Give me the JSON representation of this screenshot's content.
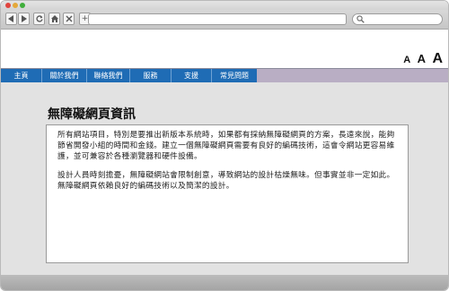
{
  "menu": {
    "items": [
      "主頁",
      "關於我們",
      "聯絡我們",
      "服務",
      "支援",
      "常見問題"
    ]
  },
  "font_size_controls": {
    "small": "A",
    "medium": "A",
    "large": "A"
  },
  "toolbar": {
    "new_tab": "+"
  },
  "main": {
    "title": "無障礙網頁資訊",
    "paragraphs": [
      "所有網站項目，特別是要推出新版本系統時，如果都有採納無障礙網頁的方案，長遠來說，能夠節省開發小組的時間和金錢。建立一個無障礙網頁需要有良好的編碼技術，這會令網站更容易維護，並可兼容於各種瀏覽器和硬件設備。",
      "設計人員時刻擔憂，無障礙網站會限制創意，導致網站的設計枯燥無味。但事實並非一定如此。無障礙網頁依賴良好的編碼技術以及簡潔的設計。"
    ]
  },
  "colors": {
    "menu_blue": "#1f6cb5",
    "menu_lavender": "#b9aec4",
    "content_bg": "#e2e2e2"
  }
}
